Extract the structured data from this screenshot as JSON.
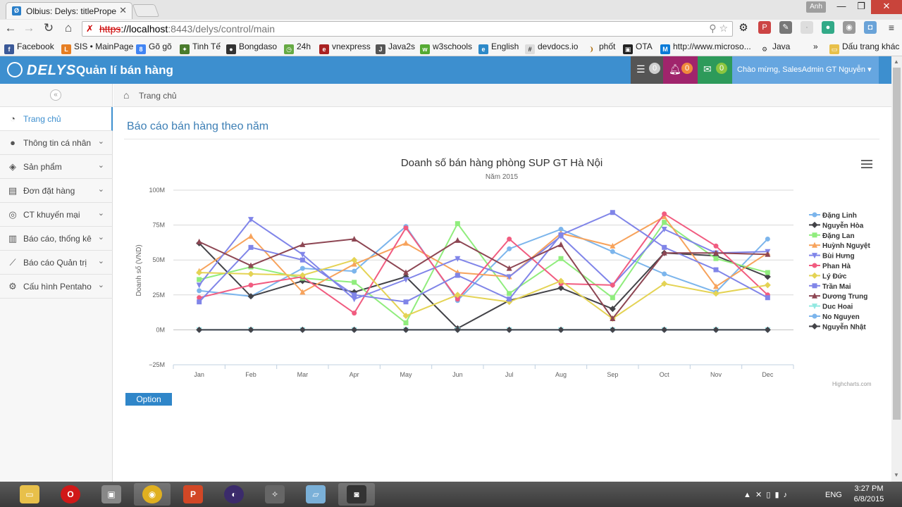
{
  "browser": {
    "tab_title": "Olbius: Delys: titleProperty",
    "user_chip": "Anh",
    "url_proto": "https",
    "url_host": "://localhost",
    "url_path": ":8443/delys/control/main",
    "bookmarks": [
      "Facebook",
      "SIS • MainPage",
      "Gõ gõ",
      "Tinh Tế",
      "Bongdaso",
      "24h",
      "vnexpress",
      "Java2s",
      "w3schools",
      "English",
      "devdocs.io",
      "phốt",
      "OTA",
      "http://www.microso...",
      "Java",
      "»",
      "Dấu trang khác"
    ]
  },
  "app": {
    "logo_text": "DELYS",
    "title": "Quản lí bán hàng",
    "badges": {
      "tasks": "0",
      "notifications": "0",
      "messages": "0"
    },
    "greeting": "Chào mừng, SalesAdmin GT Nguyễn"
  },
  "sidebar": {
    "items": [
      {
        "label": "Trang chủ",
        "icon": "dashboard-icon"
      },
      {
        "label": "Thông tin cá nhân",
        "icon": "user-icon"
      },
      {
        "label": "Sản phẩm",
        "icon": "box-icon"
      },
      {
        "label": "Đơn đặt hàng",
        "icon": "document-icon"
      },
      {
        "label": "CT khuyến mại",
        "icon": "promotion-icon"
      },
      {
        "label": "Báo cáo, thống kê",
        "icon": "bar-chart-icon"
      },
      {
        "label": "Báo cáo Quản trị",
        "icon": "line-chart-icon"
      },
      {
        "label": "Cấu hình Pentaho",
        "icon": "gear-icon"
      }
    ]
  },
  "breadcrumb": "Trang chủ",
  "page_title": "Báo cáo bán hàng theo năm",
  "option_button": "Option",
  "credit": "Highcharts.com",
  "chart_data": {
    "type": "line",
    "title": "Doanh số bán hàng phòng SUP GT Hà Nội",
    "subtitle": "Năm 2015",
    "ylabel": "Doanh số (VND)",
    "xlabel": "",
    "ylim": [
      -25,
      100
    ],
    "y_ticks": [
      "100M",
      "75M",
      "50M",
      "25M",
      "0M",
      "−25M"
    ],
    "y_tick_values": [
      100,
      75,
      50,
      25,
      0,
      -25
    ],
    "categories": [
      "Jan",
      "Feb",
      "Mar",
      "Apr",
      "May",
      "Jun",
      "Jul",
      "Aug",
      "Sep",
      "Oct",
      "Nov",
      "Dec"
    ],
    "grid": true,
    "legend": "right",
    "series": [
      {
        "name": "Đặng Linh",
        "color": "#7cb5ec",
        "marker": "circle",
        "values": [
          28,
          24,
          44,
          42,
          74,
          21,
          58,
          72,
          56,
          40,
          27,
          65
        ]
      },
      {
        "name": "Nguyễn Hòa",
        "color": "#434348",
        "marker": "diamond",
        "values": [
          62,
          24,
          35,
          27,
          38,
          1,
          21,
          30,
          15,
          55,
          53,
          38
        ]
      },
      {
        "name": "Đặng Lan",
        "color": "#90ed7d",
        "marker": "square",
        "values": [
          36,
          45,
          37,
          34,
          5,
          76,
          26,
          51,
          23,
          77,
          51,
          41
        ]
      },
      {
        "name": "Huỳnh Nguyệt",
        "color": "#f7a35c",
        "marker": "triangle",
        "values": [
          42,
          67,
          27,
          47,
          62,
          41,
          38,
          69,
          60,
          81,
          31,
          55
        ]
      },
      {
        "name": "Bùi Hưng",
        "color": "#8085e9",
        "marker": "triangle-down",
        "values": [
          32,
          79,
          54,
          22,
          36,
          51,
          38,
          67,
          32,
          72,
          55,
          56
        ]
      },
      {
        "name": "Phan Hà",
        "color": "#f15c80",
        "marker": "circle",
        "values": [
          23,
          32,
          38,
          12,
          73,
          22,
          65,
          33,
          32,
          83,
          60,
          25
        ]
      },
      {
        "name": "Lý Đức",
        "color": "#e4d354",
        "marker": "diamond",
        "values": [
          41,
          40,
          39,
          50,
          10,
          25,
          20,
          35,
          8,
          33,
          26,
          32
        ]
      },
      {
        "name": "Trần Mai",
        "color": "#8085e8",
        "marker": "square",
        "values": [
          20,
          59,
          50,
          25,
          20,
          39,
          22,
          68,
          84,
          59,
          43,
          23
        ]
      },
      {
        "name": "Dương Trung",
        "color": "#8d4653",
        "marker": "triangle",
        "values": [
          63,
          46,
          61,
          65,
          41,
          64,
          44,
          61,
          8,
          55,
          55,
          54
        ]
      },
      {
        "name": "Duc Hoai",
        "color": "#91e8e1",
        "marker": "triangle-down",
        "values": [
          0,
          0,
          0,
          0,
          0,
          0,
          0,
          0,
          0,
          0,
          0,
          0
        ]
      },
      {
        "name": "No Nguyen",
        "color": "#7cb5ec",
        "marker": "circle",
        "values": [
          0,
          0,
          0,
          0,
          0,
          0,
          0,
          0,
          0,
          0,
          0,
          0
        ]
      },
      {
        "name": "Nguyễn Nhật",
        "color": "#434348",
        "marker": "diamond",
        "values": [
          0,
          0,
          0,
          0,
          0,
          0,
          0,
          0,
          0,
          0,
          0,
          0
        ]
      }
    ]
  },
  "taskbar": {
    "language": "ENG",
    "time": "3:27 PM",
    "date": "6/8/2015",
    "apps": [
      "explorer",
      "opera",
      "vmware",
      "chrome",
      "powerpoint",
      "eclipse",
      "inkscape",
      "notepad",
      "camera"
    ]
  }
}
